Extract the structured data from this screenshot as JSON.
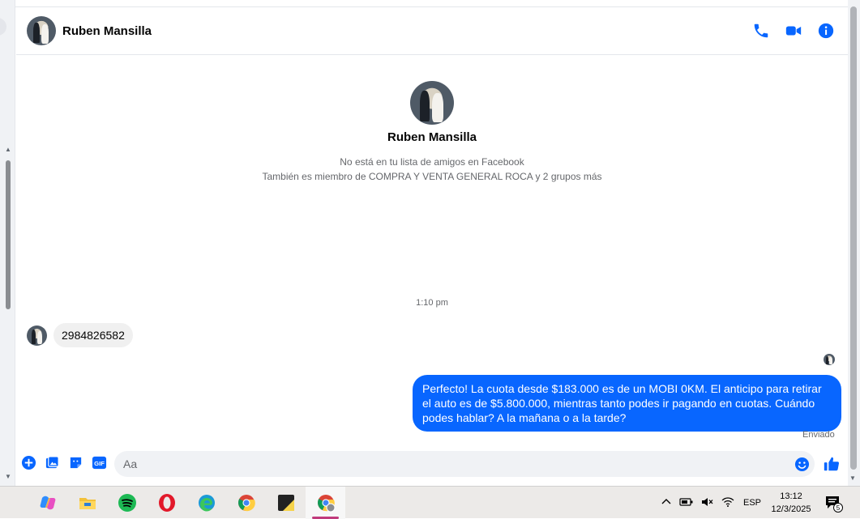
{
  "header": {
    "contact_name": "Ruben Mansilla",
    "actions": [
      "phone-icon",
      "video-camera-icon",
      "info-icon"
    ],
    "accent_color": "#0866ff"
  },
  "profile": {
    "name": "Ruben Mansilla",
    "not_friends": "No está en tu lista de amigos en Facebook",
    "groups": "También es miembro de COMPRA Y VENTA GENERAL ROCA y 2 grupos más"
  },
  "conversation": {
    "timestamp": "1:10 pm",
    "incoming_message": "2984826582",
    "outgoing_message": "Perfecto! La cuota desde $183.000 es de un MOBI 0KM. El anticipo para retirar el auto es de $5.800.000, mientras tanto podes ir pagando en cuotas. Cuándo podes hablar? A la mañana o a la tarde?",
    "status": "Enviado"
  },
  "composer": {
    "placeholder": "Aa",
    "tools": [
      "plus-circle-icon",
      "image-icon",
      "sticker-icon",
      "gif-icon"
    ],
    "gif_label": "GIF"
  },
  "taskbar": {
    "apps": [
      "copilot-icon",
      "file-explorer-icon",
      "spotify-icon",
      "opera-icon",
      "edge-icon",
      "chrome-icon",
      "sticky-notes-icon",
      "chrome-profile-icon"
    ],
    "language": "ESP",
    "time": "13:12",
    "date": "12/3/2025",
    "notification_count": "5"
  }
}
